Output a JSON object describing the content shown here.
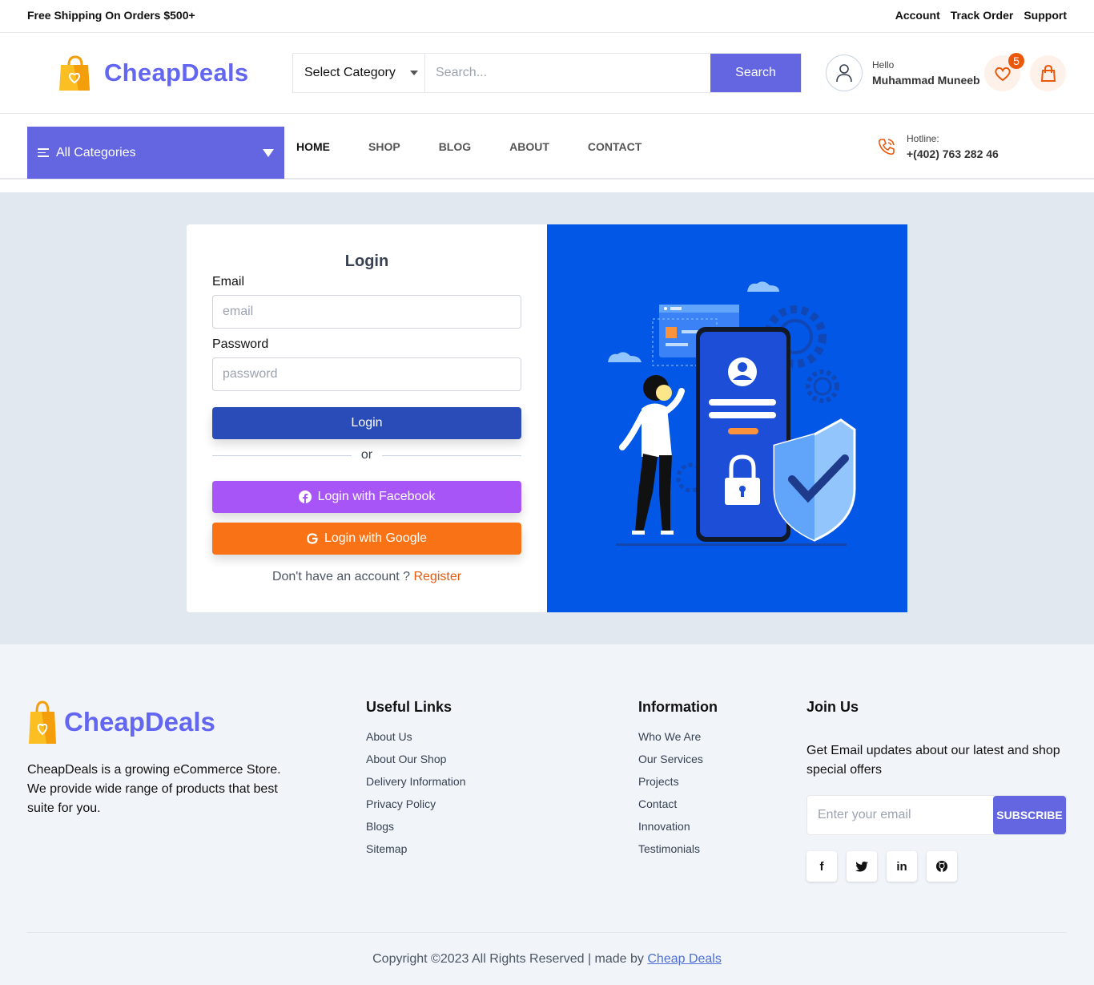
{
  "topbar": {
    "shipping": "Free Shipping On Orders $500+",
    "links": [
      "Account",
      "Track Order",
      "Support"
    ]
  },
  "header": {
    "brand": "CheapDeals",
    "category_select": "Select Category",
    "search_placeholder": "Search...",
    "search_button": "Search",
    "greeting": "Hello",
    "username": "Muhammad Muneeb",
    "wishlist_count": "5"
  },
  "nav": {
    "all_categories": "All Categories",
    "menu": [
      "HOME",
      "SHOP",
      "BLOG",
      "ABOUT",
      "CONTACT"
    ],
    "hotline_label": "Hotline:",
    "hotline_number": "+(402) 763 282 46"
  },
  "login": {
    "title": "Login",
    "email_label": "Email",
    "email_placeholder": "email",
    "password_label": "Password",
    "password_placeholder": "password",
    "login_button": "Login",
    "or": "or",
    "facebook_button": "Login with Facebook",
    "google_button": "Login with Google",
    "no_account": "Don't have an account ?",
    "register": "Register"
  },
  "footer": {
    "brand": "CheapDeals",
    "description": "CheapDeals is a growing eCommerce Store. We provide wide range of products that best suite for you.",
    "useful_links_title": "Useful Links",
    "useful_links": [
      "About Us",
      "About Our Shop",
      "Delivery Information",
      "Privacy Policy",
      "Blogs",
      "Sitemap"
    ],
    "information_title": "Information",
    "information_links": [
      "Who We Are",
      "Our Services",
      "Projects",
      "Contact",
      "Innovation",
      "Testimonials"
    ],
    "join_title": "Join Us",
    "join_text": "Get Email updates about our latest and shop special offers",
    "email_placeholder": "Enter your email",
    "subscribe": "SUBSCRIBE",
    "socials": [
      "facebook-icon",
      "twitter-icon",
      "linkedin-icon",
      "github-icon"
    ],
    "copyright": "Copyright ©2023 All Rights Reserved | made by",
    "made_by": "Cheap Deals"
  },
  "colors": {
    "accent": "#6366e0",
    "orange": "#f97316",
    "login_blue": "#2a4cb8",
    "facebook_purple": "#a855f7",
    "illustration_bg": "#0357e6"
  }
}
